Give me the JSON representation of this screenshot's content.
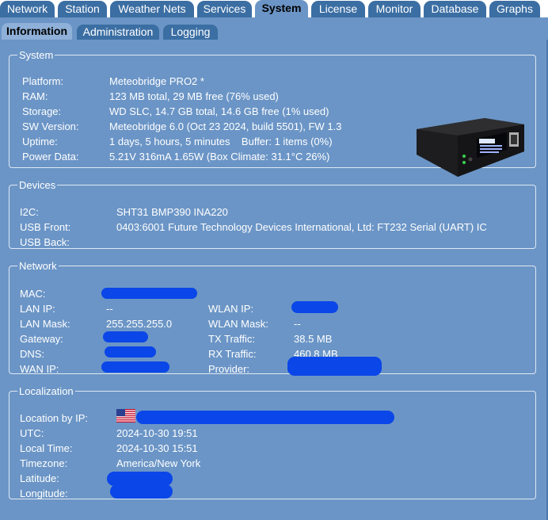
{
  "top_tabs": [
    {
      "label": "Network"
    },
    {
      "label": "Station"
    },
    {
      "label": "Weather Nets"
    },
    {
      "label": "Services"
    },
    {
      "label": "System"
    },
    {
      "label": "License"
    },
    {
      "label": "Monitor"
    },
    {
      "label": "Database"
    },
    {
      "label": "Graphs"
    }
  ],
  "sub_tabs": [
    {
      "label": "Information"
    },
    {
      "label": "Administration"
    },
    {
      "label": "Logging"
    }
  ],
  "system": {
    "legend": "System",
    "rows": [
      {
        "label": "Platform:",
        "value": "Meteobridge PRO2 *"
      },
      {
        "label": "RAM:",
        "value": "123 MB total, 29 MB free (76% used)"
      },
      {
        "label": "Storage:",
        "value": "WD SLC, 14.7 GB total, 14.6 GB free (1% used)"
      },
      {
        "label": "SW Version:",
        "value": "Meteobridge 6.0 (Oct 23 2024, build 5501), FW 1.3"
      },
      {
        "label": "Uptime:",
        "value": "1 days, 5 hours, 5 minutes    Buffer: 1 items (0%)"
      },
      {
        "label": "Power Data:",
        "value": "5.21V 316mA 1.65W (Box Climate: 31.1°C 26%)"
      }
    ]
  },
  "devices": {
    "legend": "Devices",
    "rows": [
      {
        "label": "I2C:",
        "value": "SHT31 BMP390 INA220"
      },
      {
        "label": "USB Front:",
        "value": "0403:6001 Future Technology Devices International, Ltd: FT232 Serial (UART) IC"
      },
      {
        "label": "USB Back:",
        "value": ""
      }
    ]
  },
  "network": {
    "legend": "Network",
    "left": [
      {
        "label": "MAC:",
        "value": ""
      },
      {
        "label": "LAN IP:",
        "value": "--"
      },
      {
        "label": "LAN Mask:",
        "value": "255.255.255.0"
      },
      {
        "label": "Gateway:",
        "value": ""
      },
      {
        "label": "DNS:",
        "value": ""
      },
      {
        "label": "WAN IP:",
        "value": ""
      }
    ],
    "right": [
      {
        "label": "",
        "value": ""
      },
      {
        "label": "WLAN IP:",
        "value": ""
      },
      {
        "label": "WLAN Mask:",
        "value": "--"
      },
      {
        "label": "TX Traffic:",
        "value": "38.5 MB"
      },
      {
        "label": "RX Traffic:",
        "value": "460.8 MB"
      },
      {
        "label": "Provider:",
        "value": ""
      }
    ]
  },
  "localization": {
    "legend": "Localization",
    "rows": [
      {
        "label": "Location by IP:",
        "value": ""
      },
      {
        "label": "UTC:",
        "value": "2024-10-30 19:51"
      },
      {
        "label": "Local Time:",
        "value": "2024-10-30 15:51"
      },
      {
        "label": "Timezone:",
        "value": "America/New York"
      },
      {
        "label": "Latitude:",
        "value": ""
      },
      {
        "label": "Longitude:",
        "value": ""
      }
    ]
  },
  "icons": {
    "device": "meteobridge-device-photo",
    "flag": "us-flag-icon"
  },
  "colors": {
    "panel_bg": "#6b95c6",
    "tab_bg": "#3b6ea3",
    "redaction": "#0a46e8"
  }
}
